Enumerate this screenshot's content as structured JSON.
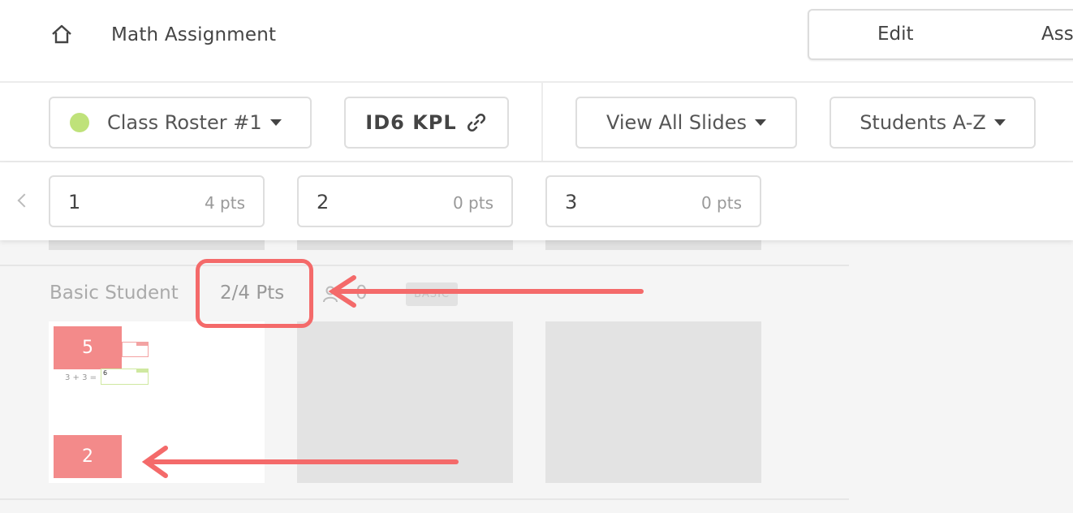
{
  "header": {
    "title": "Math Assignment",
    "mode_edit": "Edit",
    "mode_assign": "Ass"
  },
  "controls": {
    "roster": "Class Roster #1",
    "roster_dot_color": "#bfe27a",
    "class_code": "ID6 KPL",
    "view_filter": "View All Slides",
    "sort": "Students A-Z"
  },
  "slides": [
    {
      "number": "1",
      "points": "4 pts"
    },
    {
      "number": "2",
      "points": "0 pts"
    },
    {
      "number": "3",
      "points": "0 pts"
    }
  ],
  "student": {
    "name": "Basic Student",
    "points": "2/4 Pts",
    "count": "0",
    "badge": "BASIC"
  },
  "thumbnail": {
    "score_top": "5",
    "equation": "3 + 3 =",
    "answer": "6",
    "score_bottom": "2"
  },
  "colors": {
    "annotation": "#f46a6a",
    "score_box": "#f38a8a"
  }
}
